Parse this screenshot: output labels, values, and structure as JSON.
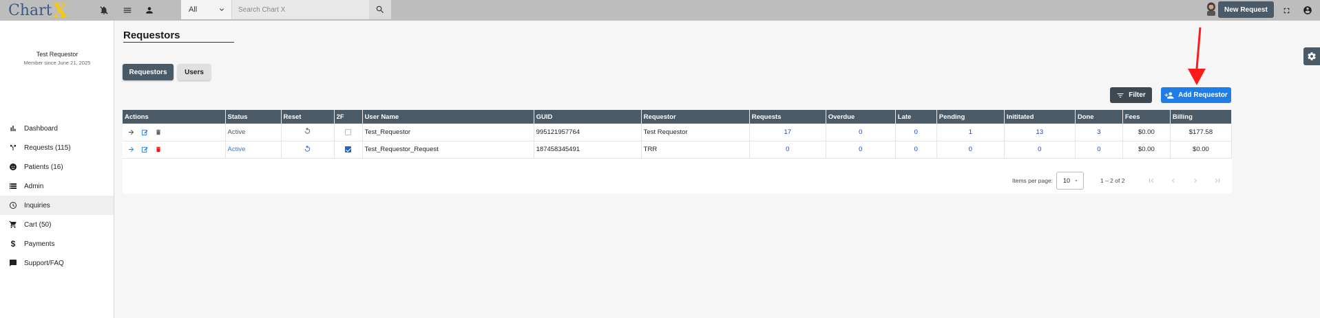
{
  "header": {
    "logo_text": "Chart",
    "logo_accent": "X",
    "search_scope": "All",
    "search_placeholder": "Search Chart X",
    "new_request_label": "New Request"
  },
  "sidebar": {
    "profile_name": "Test Requestor",
    "member_since": "Member since June 21, 2025",
    "items": [
      {
        "label": "Dashboard",
        "icon": "bar-chart-icon"
      },
      {
        "label": "Requests (115)",
        "icon": "requests-icon"
      },
      {
        "label": "Patients (16)",
        "icon": "face-icon"
      },
      {
        "label": "Admin",
        "icon": "storage-icon"
      },
      {
        "label": "Inquiries",
        "icon": "clock-icon"
      },
      {
        "label": "Cart (50)",
        "icon": "cart-icon"
      },
      {
        "label": "Payments",
        "icon": "dollar-icon"
      },
      {
        "label": "Support/FAQ",
        "icon": "chat-icon"
      }
    ]
  },
  "main": {
    "title": "Requestors",
    "tabs": [
      {
        "label": "Requestors"
      },
      {
        "label": "Users"
      }
    ],
    "filter_label": "Filter",
    "add_label": "Add Requestor"
  },
  "table": {
    "columns": [
      "Actions",
      "Status",
      "Reset",
      "2F",
      "User Name",
      "GUID",
      "Requestor",
      "Requests",
      "Overdue",
      "Late",
      "Pending",
      "Inititated",
      "Done",
      "Fees",
      "Billing"
    ],
    "rows": [
      {
        "status": "Active",
        "two_factor": false,
        "user_name": "Test_Requestor",
        "guid": "995121957764",
        "requestor": "Test Requestor",
        "requests": "17",
        "overdue": "0",
        "late": "0",
        "pending": "1",
        "initiated": "13",
        "done": "3",
        "fees": "$0.00",
        "billing": "$177.58"
      },
      {
        "status": "Active",
        "two_factor": true,
        "user_name": "Test_Requestor_Request",
        "guid": "187458345491",
        "requestor": "TRR",
        "requests": "0",
        "overdue": "0",
        "late": "0",
        "pending": "0",
        "initiated": "0",
        "done": "0",
        "fees": "$0.00",
        "billing": "$0.00"
      }
    ]
  },
  "paginator": {
    "items_per_page_label": "Items per page:",
    "page_size": "10",
    "range_label": "1 – 2 of 2"
  },
  "colors": {
    "accent_blue": "#1e7ee6",
    "header_slate": "#4a5a66",
    "annotation_red": "#ff1a1a"
  }
}
